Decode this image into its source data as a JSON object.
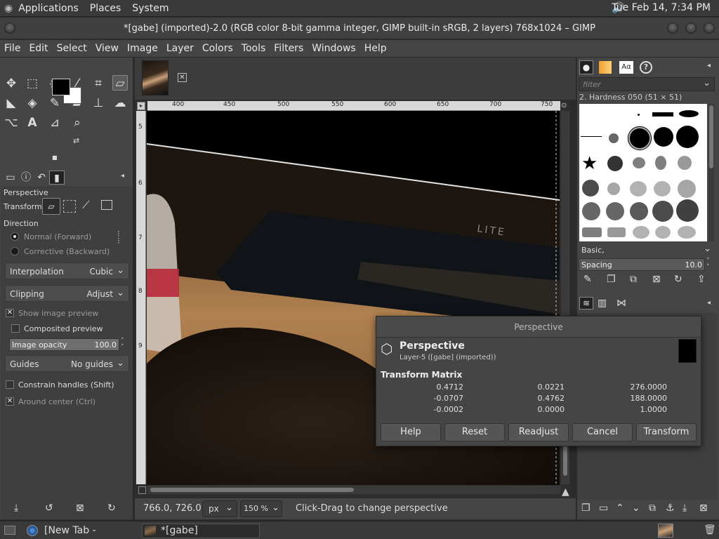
{
  "panel": {
    "menus": [
      "Applications",
      "Places",
      "System"
    ],
    "clock": "Tue Feb 14,  7:34 PM"
  },
  "window": {
    "title": "*[gabe] (imported)-2.0 (RGB color 8-bit gamma integer, GIMP built-in sRGB, 2 layers) 768x1024 – GIMP"
  },
  "menubar": [
    "File",
    "Edit",
    "Select",
    "View",
    "Image",
    "Layer",
    "Colors",
    "Tools",
    "Filters",
    "Windows",
    "Help"
  ],
  "tool_options": {
    "title": "Perspective",
    "transform_label": "Transform:",
    "direction_label": "Direction",
    "direction_normal": "Normal (Forward)",
    "direction_corrective": "Corrective (Backward)",
    "interpolation_label": "Interpolation",
    "interpolation_value": "Cubic",
    "clipping_label": "Clipping",
    "clipping_value": "Adjust",
    "show_preview": "Show image preview",
    "composited_preview": "Composited preview",
    "opacity_label": "Image opacity",
    "opacity_value": "100.0",
    "opacity_fraction": 1.0,
    "guides_label": "Guides",
    "guides_value": "No guides",
    "constrain": "Constrain handles (Shift)",
    "around_center": "Around center (Ctrl)"
  },
  "ruler": {
    "h_ticks": [
      "400",
      "450",
      "500",
      "550",
      "600",
      "650",
      "700",
      "750"
    ],
    "v_ticks": [
      "5",
      "6",
      "7",
      "8",
      "9"
    ]
  },
  "photo": {
    "brand": "LITE"
  },
  "statusbar": {
    "coords": "766.0, 726.0",
    "unit": "px",
    "zoom": "150 %",
    "message": "Click-Drag to change perspective"
  },
  "brushes": {
    "filter_placeholder": "filter",
    "selected": "2. Hardness 050 (51 × 51)",
    "tag": "Basic,",
    "spacing_label": "Spacing",
    "spacing_value": "10.0"
  },
  "dialog": {
    "window_title": "Perspective",
    "heading": "Perspective",
    "subtitle": "Layer-5 ([gabe] (imported))",
    "matrix_label": "Transform Matrix",
    "matrix": [
      [
        "0.4712",
        "0.0221",
        "276.0000"
      ],
      [
        "-0.0707",
        "0.4762",
        "188.0000"
      ],
      [
        "-0.0002",
        "0.0000",
        "1.0000"
      ]
    ],
    "buttons": {
      "help": "Help",
      "reset": "Reset",
      "readjust": "Readjust",
      "cancel": "Cancel",
      "transform": "Transform"
    }
  },
  "taskbar": {
    "chromium": "[New Tab - Chromi...",
    "gimp": "*[gabe] (imported)-..."
  }
}
